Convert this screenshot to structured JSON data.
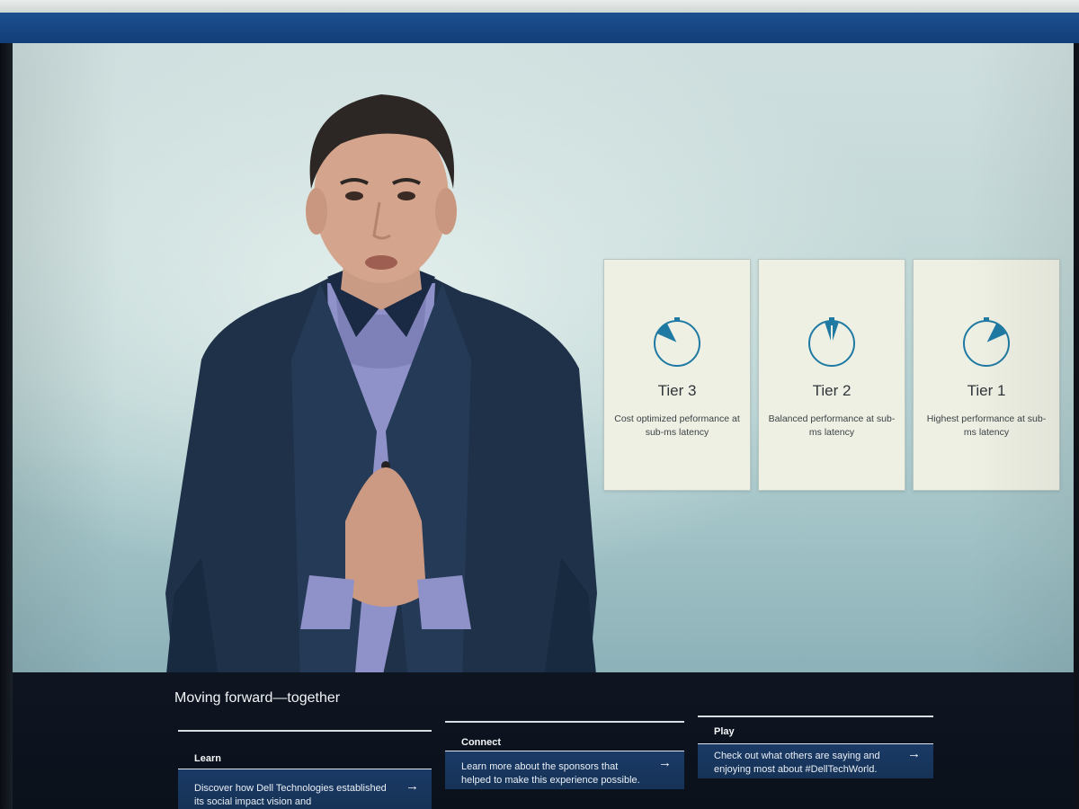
{
  "presentation": {
    "tiers": [
      {
        "name": "Tier 3",
        "description": "Cost optimized peformance at sub-ms latency",
        "gauge_icon": "speedometer-low-icon"
      },
      {
        "name": "Tier 2",
        "description": "Balanced performance at sub-ms latency",
        "gauge_icon": "speedometer-mid-icon"
      },
      {
        "name": "Tier 1",
        "description": "Highest performance at sub-ms latency",
        "gauge_icon": "speedometer-high-icon"
      }
    ],
    "accent_color": "#1f7aa3"
  },
  "bottom": {
    "title": "Moving forward—together",
    "columns": [
      {
        "label": "Learn",
        "description": "Discover how Dell Technologies established its social impact vision and",
        "arrow": "→"
      },
      {
        "label": "Connect",
        "description": "Learn more about the sponsors that helped to make this experience possible.",
        "arrow": "→"
      },
      {
        "label": "Play",
        "description": "Check out what others are saying and enjoying most about #DellTechWorld.",
        "arrow": "→"
      }
    ],
    "panel_color": "#163256"
  }
}
